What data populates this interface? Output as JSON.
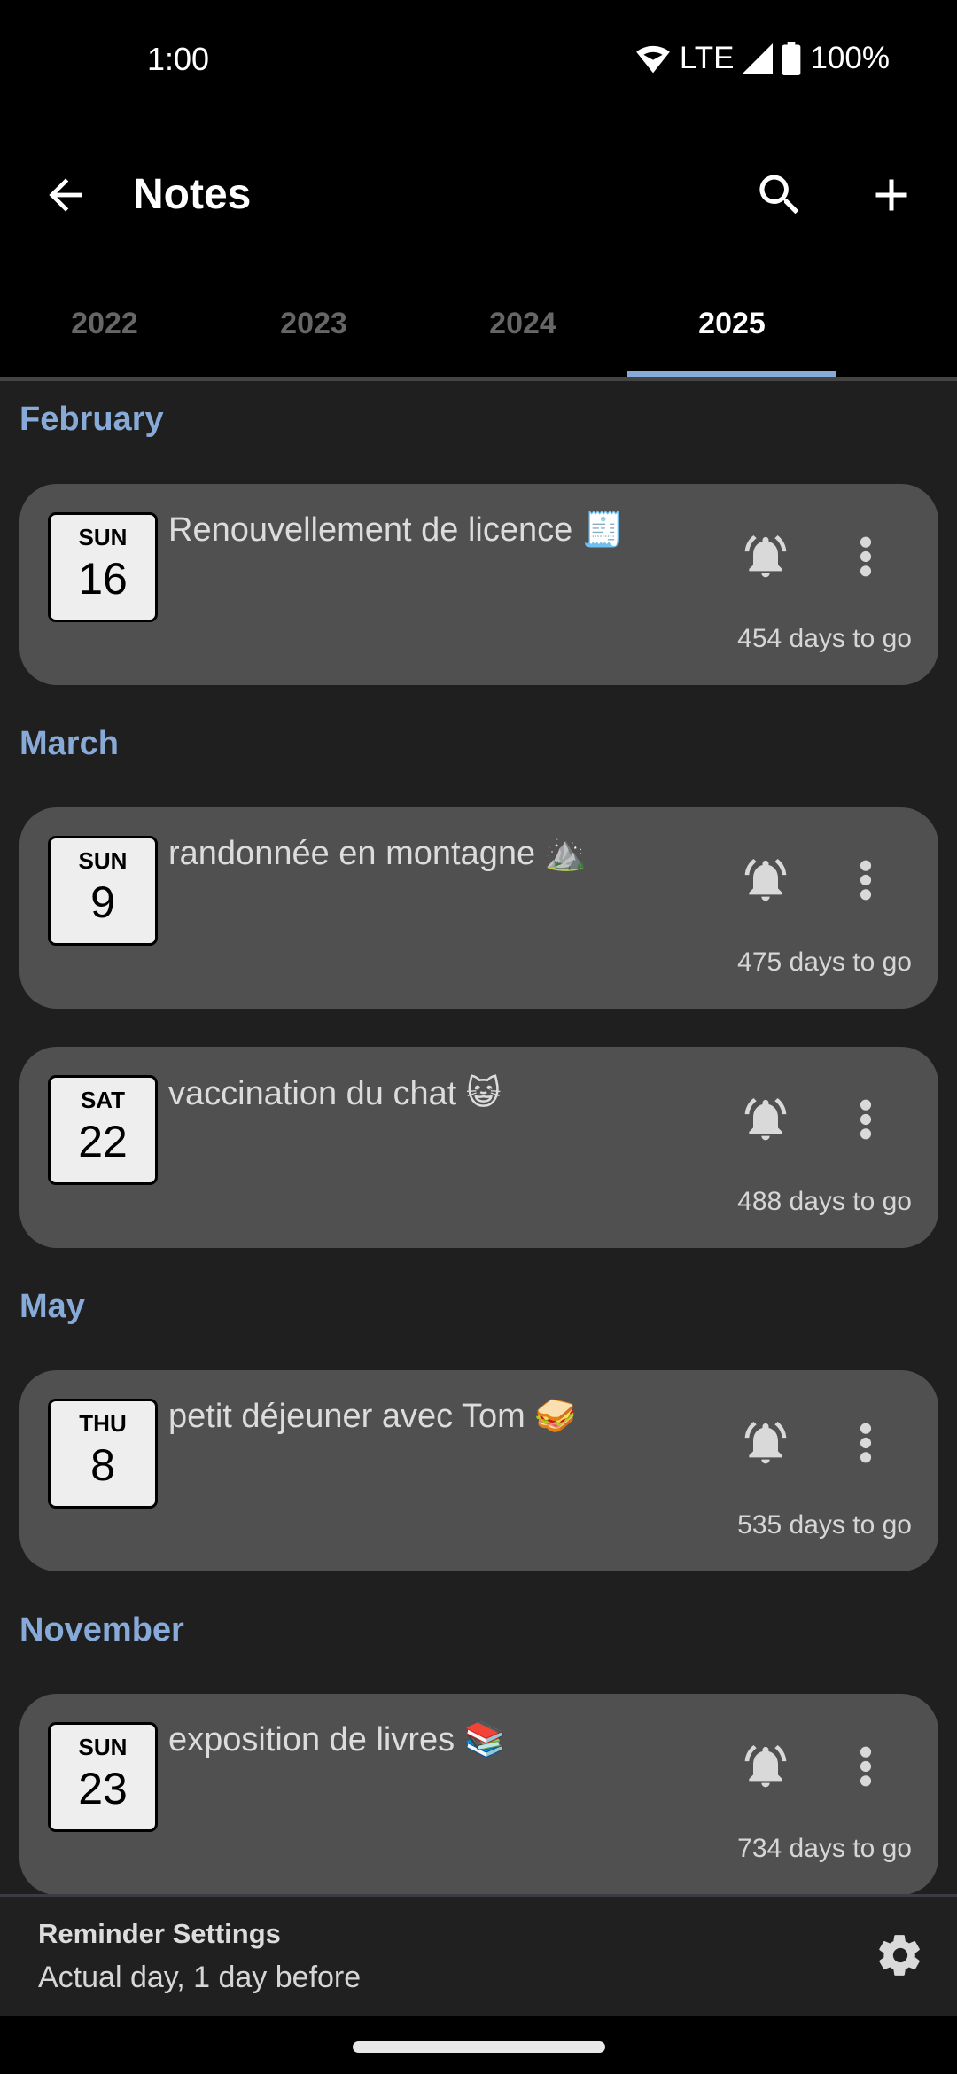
{
  "status_bar": {
    "time": "1:00",
    "network": "LTE",
    "battery": "100%",
    "icons": [
      "wifi-icon",
      "signal-icon",
      "battery-icon"
    ]
  },
  "app_bar": {
    "title": "Notes",
    "back_icon": "arrow-back-icon",
    "search_icon": "search-icon",
    "add_icon": "plus-icon"
  },
  "tabs": [
    {
      "label": "2022",
      "active": false
    },
    {
      "label": "2023",
      "active": false
    },
    {
      "label": "2024",
      "active": false
    },
    {
      "label": "2025",
      "active": true
    }
  ],
  "colors": {
    "accent": "#88aad8",
    "background": "#1f1f1f",
    "card": "#505050",
    "badge": "#eeeeee"
  },
  "sections": [
    {
      "month": "February",
      "notes": [
        {
          "dow": "SUN",
          "day": "16",
          "title": "Renouvellement de licence 🧾",
          "days_to_go": "454 days to go"
        }
      ]
    },
    {
      "month": "March",
      "notes": [
        {
          "dow": "SUN",
          "day": "9",
          "title": "randonnée en montagne ⛰️",
          "days_to_go": "475 days to go"
        },
        {
          "dow": "SAT",
          "day": "22",
          "title": "vaccination du chat 😺",
          "days_to_go": "488 days to go"
        }
      ]
    },
    {
      "month": "May",
      "notes": [
        {
          "dow": "THU",
          "day": "8",
          "title": "petit déjeuner avec Tom 🥪",
          "days_to_go": "535 days to go"
        }
      ]
    },
    {
      "month": "November",
      "notes": [
        {
          "dow": "SUN",
          "day": "23",
          "title": "exposition de livres 📚",
          "days_to_go": "734 days to go"
        }
      ]
    }
  ],
  "reminder_settings": {
    "title": "Reminder Settings",
    "value": "Actual day, 1 day before",
    "icon": "gear-icon"
  }
}
